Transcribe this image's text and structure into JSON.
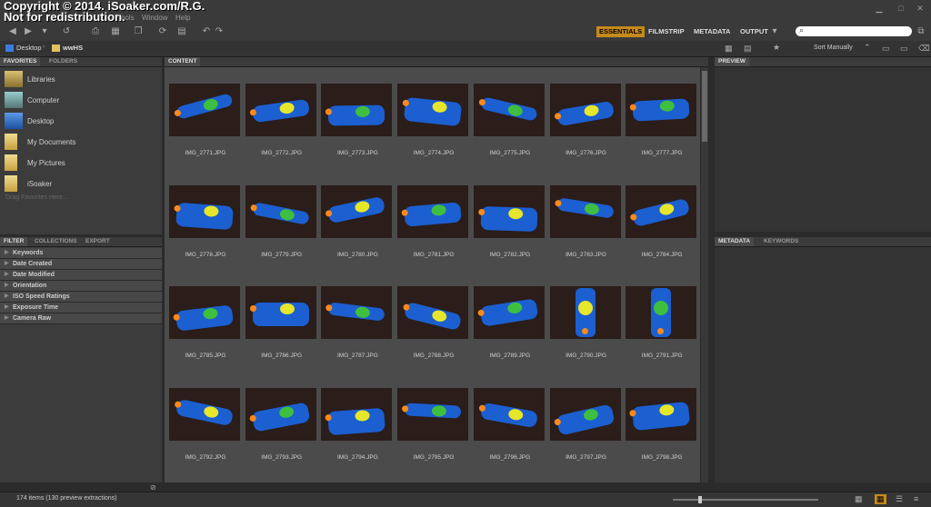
{
  "watermark": {
    "line1": "Copyright © 2014. iSoaker.com/R.G.",
    "line2": "Not for redistribution."
  },
  "menu": [
    "Tools",
    "Window",
    "Help"
  ],
  "workspaces": [
    "ESSENTIALS",
    "FILMSTRIP",
    "METADATA",
    "OUTPUT"
  ],
  "breadcrumb": [
    "Desktop",
    "wwHS"
  ],
  "sort_label": "Sort Manually",
  "tabs": {
    "left_top": [
      "FAVORITES",
      "FOLDERS"
    ],
    "left_bottom": [
      "FILTER",
      "COLLECTIONS",
      "EXPORT"
    ],
    "content": "CONTENT",
    "preview": "PREVIEW",
    "right_bottom": [
      "METADATA",
      "KEYWORDS"
    ]
  },
  "favorites": [
    "Libraries",
    "Computer",
    "Desktop",
    "My Documents",
    "My Pictures",
    "iSoaker"
  ],
  "drag_hint": "Drag Favorites Here...",
  "filters": [
    "Keywords",
    "Date Created",
    "Date Modified",
    "Orientation",
    "ISO Speed Ratings",
    "Exposure Time",
    "Camera Raw"
  ],
  "thumbnails": [
    "IMG_2771.JPG",
    "IMG_2772.JPG",
    "IMG_2773.JPG",
    "IMG_2774.JPG",
    "IMG_2775.JPG",
    "IMG_2776.JPG",
    "IMG_2777.JPG",
    "IMG_2778.JPG",
    "IMG_2779.JPG",
    "IMG_2780.JPG",
    "IMG_2781.JPG",
    "IMG_2782.JPG",
    "IMG_2783.JPG",
    "IMG_2784.JPG",
    "IMG_2785.JPG",
    "IMG_2786.JPG",
    "IMG_2787.JPG",
    "IMG_2788.JPG",
    "IMG_2789.JPG",
    "IMG_2790.JPG",
    "IMG_2791.JPG",
    "IMG_2792.JPG",
    "IMG_2793.JPG",
    "IMG_2794.JPG",
    "IMG_2795.JPG",
    "IMG_2796.JPG",
    "IMG_2797.JPG",
    "IMG_2798.JPG"
  ],
  "status": "174 items (130 preview extractions)",
  "colors": {
    "accent": "#c68a1a",
    "toy_blue": "#1c5fd0",
    "toy_yellow": "#e6e62a",
    "toy_green": "#3fbf3f",
    "toy_orange": "#ff8a1a"
  }
}
